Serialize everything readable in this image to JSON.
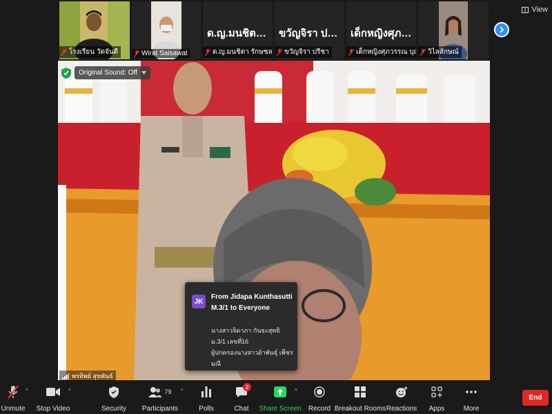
{
  "gallery": {
    "tiles": [
      {
        "name": "โรงเรียน วัดจันดี",
        "has_video": true
      },
      {
        "name": "Wirat Saisawat",
        "has_video": true
      },
      {
        "name": "ด.ญ.มนชิตา รักษชล",
        "big_name": "ด.ญ.มนชิตา รักษ...",
        "has_video": false
      },
      {
        "name": "ขวัญจิรา ปรีชา",
        "big_name": "ขวัญจิรา ปรีชา",
        "has_video": false
      },
      {
        "name": "เด็กหญิงศุภวรรณ บุญทอง",
        "big_name": "เด็กหญิงศุภวรรณ...",
        "has_video": false
      },
      {
        "name": "วิไลลักษณ์",
        "has_video": true
      }
    ],
    "view_label": "View"
  },
  "main_video": {
    "sound_label": "Original Sound: Off",
    "speaker_name": "พรทิพย์ สุขพันธ์"
  },
  "chat_popup": {
    "avatar_initials": "JK",
    "from": "From Jidapa Kunthasutti M.3/1 to Everyone",
    "message_line1": "นางสาวจิดาภา กันธะสุทธิ ม.3/1 เลขที่16",
    "message_line2": "ผู้ปกครองนางสาวผ้าพันธุ์ เพ็ชรมณี"
  },
  "toolbar": {
    "unmute": "Unmute",
    "stop_video": "Stop Video",
    "security": "Security",
    "participants": "Participants",
    "participants_count": "79",
    "polls": "Polls",
    "chat": "Chat",
    "chat_badge": "2",
    "share_screen": "Share Screen",
    "record": "Record",
    "breakout_rooms": "Breakout Rooms",
    "reactions": "Reactions",
    "apps": "Apps",
    "more": "More",
    "end": "End"
  },
  "colors": {
    "accent_blue": "#2d8cff",
    "end_red": "#e02828",
    "share_green": "#23d959",
    "avatar_purple": "#7b4ccf"
  }
}
